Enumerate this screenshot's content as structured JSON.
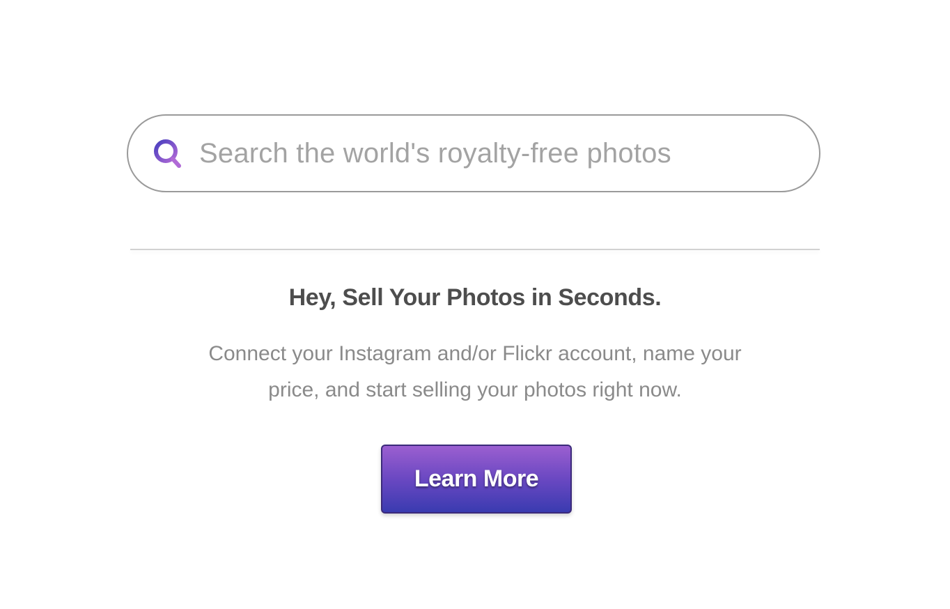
{
  "search": {
    "placeholder": "Search the world's royalty-free photos",
    "value": "",
    "icon": "search-icon"
  },
  "promo": {
    "headline": "Hey, Sell Your Photos in Seconds.",
    "description": "Connect your Instagram and/or Flickr account, name your price, and start selling your photos right now.",
    "button_label": "Learn More"
  },
  "colors": {
    "accent_top": "#9b5fd0",
    "accent_bottom": "#3a3bb0",
    "headline_text": "#4d4d4d",
    "body_text": "#8a8a8a"
  }
}
